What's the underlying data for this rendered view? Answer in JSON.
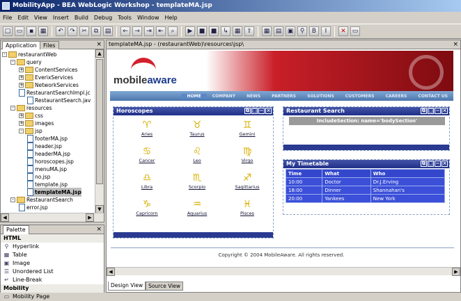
{
  "window": {
    "title": "MobilityApp - BEA WebLogic Workshop - templateMA.jsp"
  },
  "menu": [
    "File",
    "Edit",
    "View",
    "Insert",
    "Build",
    "Debug",
    "Tools",
    "Window",
    "Help"
  ],
  "toolbar_icons": [
    "new-icon",
    "open-icon",
    "save-icon",
    "save-all-icon",
    "undo-icon",
    "redo-icon",
    "cut-icon",
    "copy-icon",
    "paste-icon",
    "back-icon",
    "forward-icon",
    "indent-icon",
    "outdent-icon",
    "find-icon",
    "run-icon",
    "debug-icon",
    "stop-icon",
    "step-icon",
    "build-icon",
    "deploy-icon",
    "grid-icon",
    "table-icon",
    "image-icon",
    "link-icon",
    "bold-icon",
    "italic-icon",
    "delete-icon",
    "form-icon"
  ],
  "left_panel": {
    "tabs": [
      "Application",
      "Files"
    ],
    "tree": [
      {
        "label": "restaurantWeb",
        "level": 0,
        "type": "folder",
        "exp": "-"
      },
      {
        "label": "query",
        "level": 1,
        "type": "folder",
        "exp": "-"
      },
      {
        "label": "ContentServices",
        "level": 2,
        "type": "folder",
        "exp": "+"
      },
      {
        "label": "EverixServices",
        "level": 2,
        "type": "folder",
        "exp": "+"
      },
      {
        "label": "NetworkServices",
        "level": 2,
        "type": "folder",
        "exp": "+"
      },
      {
        "label": "RestaurantSearchImpl.jc",
        "level": 2,
        "type": "file",
        "exp": ""
      },
      {
        "label": "RestaurantSearch.jav",
        "level": 3,
        "type": "file",
        "exp": ""
      },
      {
        "label": "resources",
        "level": 1,
        "type": "folder",
        "exp": "-"
      },
      {
        "label": "css",
        "level": 2,
        "type": "folder",
        "exp": "+"
      },
      {
        "label": "images",
        "level": 2,
        "type": "folder",
        "exp": "+"
      },
      {
        "label": "jsp",
        "level": 2,
        "type": "folder",
        "exp": "-"
      },
      {
        "label": "footerMA.jsp",
        "level": 3,
        "type": "file",
        "exp": ""
      },
      {
        "label": "header.jsp",
        "level": 3,
        "type": "file",
        "exp": ""
      },
      {
        "label": "headerMA.jsp",
        "level": 3,
        "type": "file",
        "exp": ""
      },
      {
        "label": "horoscopes.jsp",
        "level": 3,
        "type": "file",
        "exp": ""
      },
      {
        "label": "menuMA.jsp",
        "level": 3,
        "type": "file",
        "exp": ""
      },
      {
        "label": "no.jsp",
        "level": 3,
        "type": "file",
        "exp": ""
      },
      {
        "label": "template.jsp",
        "level": 3,
        "type": "file",
        "exp": ""
      },
      {
        "label": "templateMA.jsp",
        "level": 3,
        "type": "file",
        "exp": "",
        "selected": true
      },
      {
        "label": "RestaurantSearch",
        "level": 1,
        "type": "folder",
        "exp": "-"
      },
      {
        "label": "error.jsp",
        "level": 2,
        "type": "file",
        "exp": ""
      }
    ]
  },
  "palette": {
    "title": "Palette",
    "items": [
      {
        "label": "HTML",
        "header": true,
        "icon": ""
      },
      {
        "label": "Hyperlink",
        "header": false,
        "icon": "hyperlink-icon"
      },
      {
        "label": "Table",
        "header": false,
        "icon": "table-icon"
      },
      {
        "label": "Image",
        "header": false,
        "icon": "image-icon"
      },
      {
        "label": "Unordered List",
        "header": false,
        "icon": "list-icon"
      },
      {
        "label": "Line-Break",
        "header": false,
        "icon": "line-break-icon"
      },
      {
        "label": "Mobility",
        "header": true,
        "icon": ""
      },
      {
        "label": "Mobility Page",
        "header": false,
        "icon": "page-icon"
      }
    ]
  },
  "editor": {
    "path": "templateMA.jsp - (restaurantWeb)\\resources\\jsp\\",
    "banner": {
      "logo_left": "mobile",
      "logo_right": "aware"
    },
    "nav": [
      "HOME",
      "COMPANY",
      "NEWS",
      "PARTNERS",
      "SOLUTIONS",
      "CUSTOMERS",
      "CAREERS",
      "CONTACT US"
    ],
    "horoscopes": {
      "title": "Horoscopes",
      "signs": [
        {
          "name": "Aries",
          "glyph": "♈"
        },
        {
          "name": "Taurus",
          "glyph": "♉"
        },
        {
          "name": "Gemini",
          "glyph": "♊"
        },
        {
          "name": "Cancer",
          "glyph": "♋"
        },
        {
          "name": "Leo",
          "glyph": "♌"
        },
        {
          "name": "Virgo",
          "glyph": "♍"
        },
        {
          "name": "Libra",
          "glyph": "♎"
        },
        {
          "name": "Scorpio",
          "glyph": "♏"
        },
        {
          "name": "Sagittarius",
          "glyph": "♐"
        },
        {
          "name": "Capricorn",
          "glyph": "♑"
        },
        {
          "name": "Aquarius",
          "glyph": "♒"
        },
        {
          "name": "Pisces",
          "glyph": "♓"
        }
      ]
    },
    "search": {
      "title": "Restaurant Search",
      "include": "IncludeSection: name='bodySection'"
    },
    "timetable": {
      "title": "My Timetable",
      "headers": [
        "Time",
        "What",
        "Who"
      ],
      "rows": [
        [
          "10:00",
          "Doctor",
          "Dr.J.Erving"
        ],
        [
          "18:00",
          "Dinner",
          "Shannahan's"
        ],
        [
          "20:00",
          "Yankees",
          "New York"
        ]
      ]
    },
    "copyright": "Copyright © 2004 MobileAware. All rights reserved.",
    "bottom_tabs": [
      "Design View",
      "Source View"
    ]
  },
  "colors": {
    "accent_red": "#c91f28",
    "box_blue": "#2a3a90",
    "nav_blue": "#4d77ae"
  }
}
